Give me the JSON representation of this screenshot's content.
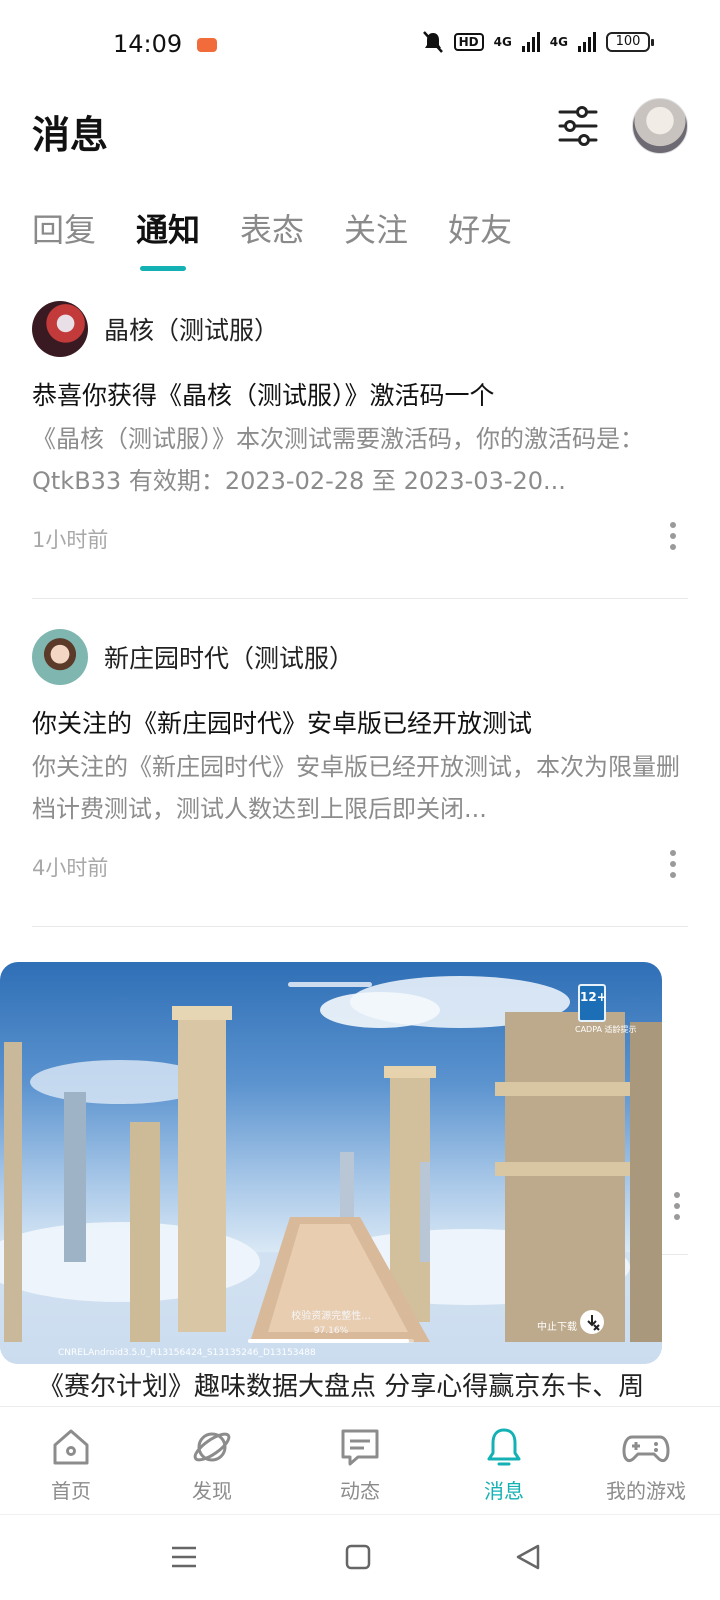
{
  "status_bar": {
    "time": "14:09",
    "hd_label": "HD",
    "net1": "4G",
    "net2": "4G",
    "battery": "100"
  },
  "header": {
    "title": "消息"
  },
  "tabs": [
    {
      "label": "回复"
    },
    {
      "label": "通知"
    },
    {
      "label": "表态"
    },
    {
      "label": "关注"
    },
    {
      "label": "好友"
    }
  ],
  "notifications": [
    {
      "sender": "晶核（测试服）",
      "title": "恭喜你获得《晶核（测试服）》激活码一个",
      "body": "《晶核（测试服）》本次测试需要激活码，你的激活码是：QtkB33 有效期：2023-02-28 至 2023-03-20...",
      "time": "1小时前"
    },
    {
      "sender": "新庄园时代（测试服）",
      "title": "你关注的《新庄园时代》安卓版已经开放测试",
      "body": "你关注的《新庄园时代》安卓版已经开放测试，本次为限量删档计费测试，测试人数达到上限后即关闭...",
      "time": "4小时前"
    }
  ],
  "floating_window": {
    "age_rating": "12+",
    "age_sub": "CADPA 适龄提示",
    "loading_text": "校验资源完整性...",
    "loading_percent": "97.16%",
    "loading_progress": 0.9716,
    "stop_download": "中止下载",
    "build_info": "CNRELAndroid3.5.0_R13156424_S13135246_D13153488"
  },
  "peek_title": "《赛尔计划》趣味数据大盘点 分享心得赢京东卡、周",
  "bottom_nav": [
    {
      "label": "首页",
      "icon": "home-icon"
    },
    {
      "label": "发现",
      "icon": "planet-icon"
    },
    {
      "label": "动态",
      "icon": "message-icon"
    },
    {
      "label": "消息",
      "icon": "bell-icon"
    },
    {
      "label": "我的游戏",
      "icon": "gamepad-icon"
    }
  ],
  "colors": {
    "accent": "#14b1b4",
    "text_primary": "#111111",
    "text_secondary": "#8c8c8c"
  }
}
